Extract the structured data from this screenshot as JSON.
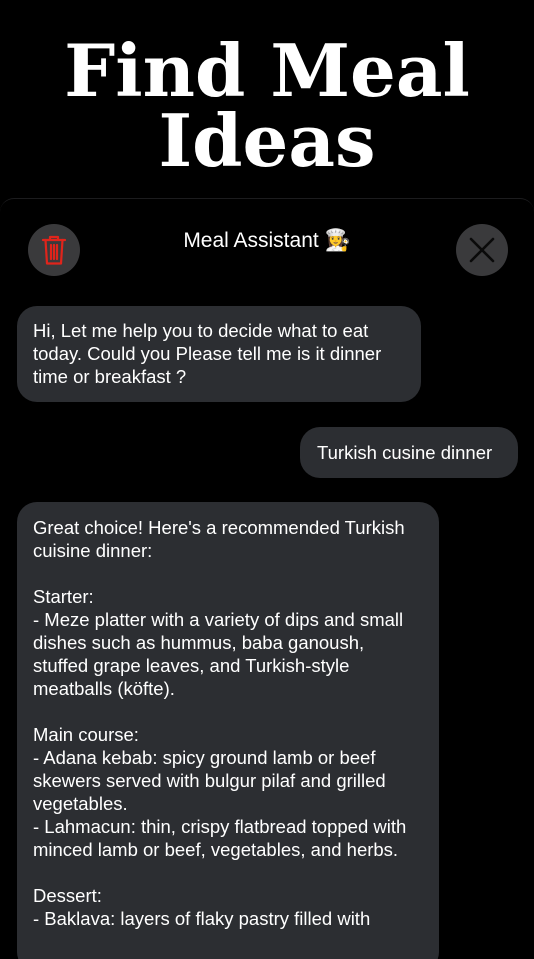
{
  "headline": {
    "line1": "Find Meal",
    "line2": "Ideas"
  },
  "chat": {
    "title": "Meal Assistant 👩‍🍳",
    "delete_icon": "trash-icon",
    "close_icon": "close-icon",
    "accent_color": "#e0241b",
    "messages": [
      {
        "role": "assistant",
        "text": "Hi, Let me help you to decide what to eat today. Could you Please tell me is it dinner time or breakfast ?"
      },
      {
        "role": "user",
        "text": "Turkish cusine dinner"
      },
      {
        "role": "assistant",
        "text": "Great choice! Here's a recommended Turkish cuisine dinner:\n\nStarter:\n- Meze platter with a variety of dips and small dishes such as hummus, baba ganoush, stuffed grape leaves, and Turkish-style meatballs (köfte).\n\nMain course:\n- Adana kebab: spicy ground lamb or beef skewers served with bulgur pilaf and grilled vegetables.\n- Lahmacun: thin, crispy flatbread topped with minced lamb or beef, vegetables, and herbs.\n\nDessert:\n- Baklava: layers of flaky pastry filled with"
      }
    ]
  }
}
